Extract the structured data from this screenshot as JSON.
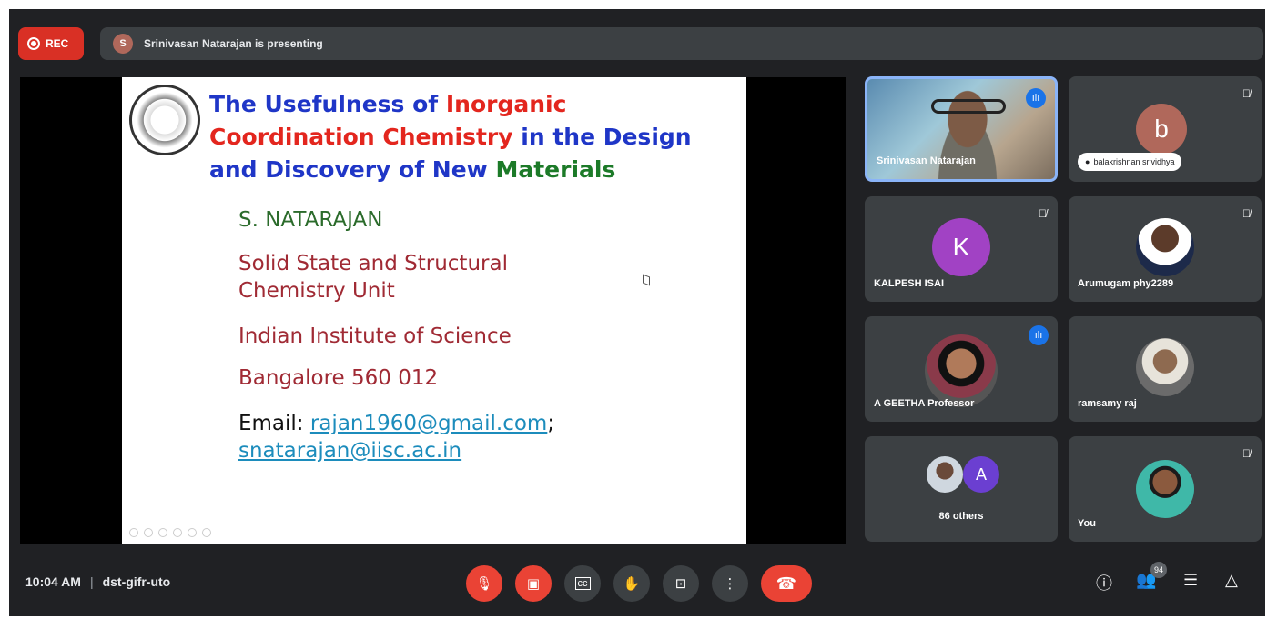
{
  "topbar": {
    "rec_label": "REC",
    "presenter_initial": "S",
    "presenting_text": "Srinivasan Natarajan is presenting"
  },
  "slide": {
    "title_part1": "The Usefulness of ",
    "title_part2": "Inorganic",
    "title_part3": "Coordination Chemistry",
    "title_part4": " in the Design",
    "title_part5": "and Discovery of New ",
    "title_part6": "Materials",
    "author": "S. NATARAJAN",
    "dept_line1": "Solid State and Structural",
    "dept_line2": "Chemistry Unit",
    "institute": "Indian Institute of Science",
    "city": "Bangalore 560 012",
    "email_label": "Email: ",
    "email1": "rajan1960@gmail.com",
    "email_sep": ";",
    "email2": "snatarajan@iisc.ac.in"
  },
  "participants": [
    {
      "name": "Srinivasan Natarajan",
      "status": "speaking"
    },
    {
      "name": "balakrishnan srividhya",
      "initial": "b",
      "status": "muted",
      "color": "#b0685b"
    },
    {
      "name": "KALPESH ISAI",
      "initial": "K",
      "status": "muted",
      "color": "#a142c4"
    },
    {
      "name": "Arumugam phy2289",
      "status": "muted"
    },
    {
      "name": "A GEETHA Professor",
      "status": "speaking"
    },
    {
      "name": "ramsamy raj",
      "status": "none"
    },
    {
      "name": "86 others",
      "initial": "A",
      "color": "#6b3fd1"
    },
    {
      "name": "You",
      "status": "muted"
    }
  ],
  "bottombar": {
    "time": "10:04 AM",
    "separator": "|",
    "meeting_code": "dst-gifr-uto",
    "people_count": "94"
  },
  "icons": {
    "mic_off": "mic-off-icon",
    "cam_off": "camera-off-icon",
    "captions": "captions-icon",
    "hand": "raise-hand-icon",
    "present": "present-icon",
    "more": "more-vert-icon",
    "end": "end-call-icon",
    "info": "info-icon",
    "people": "people-icon",
    "chat": "chat-icon",
    "activities": "activities-icon"
  }
}
